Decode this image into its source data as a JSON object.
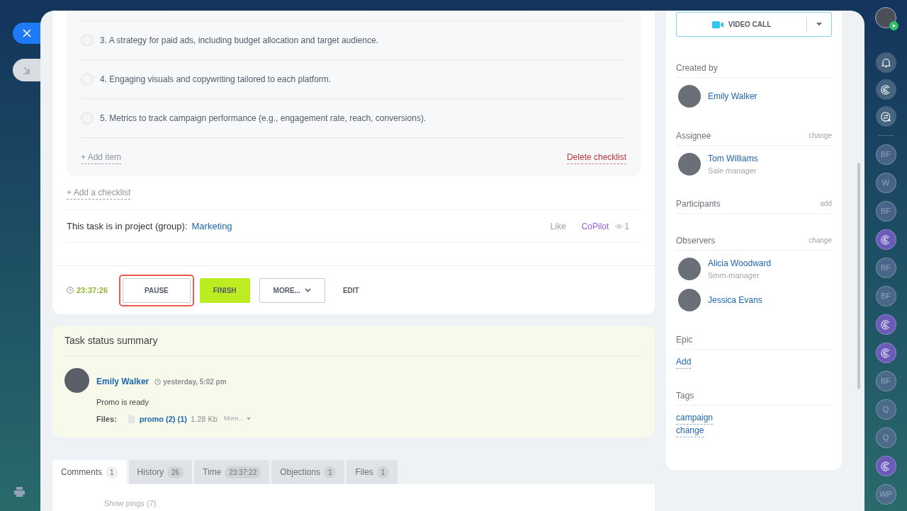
{
  "checklist": {
    "items": [
      {
        "text": "3. A strategy for paid ads, including budget allocation and target audience.",
        "checked": false
      },
      {
        "text": "4. Engaging visuals and copywriting tailored to each platform.",
        "checked": false
      },
      {
        "text": "5. Metrics to track campaign performance (e.g., engagement rate, reach, conversions).",
        "checked": false
      }
    ],
    "add_item": "+ Add item",
    "delete": "Delete checklist"
  },
  "add_checklist": "+ Add a checklist",
  "project": {
    "label": "This task is in project (group):",
    "link": "Marketing",
    "like": "Like",
    "copilot": "CoPilot",
    "views": "1"
  },
  "actions": {
    "timer": "23:37:26",
    "buttons": [
      {
        "label": "PAUSE",
        "kind": "outline",
        "highlighted": true
      },
      {
        "label": "FINISH",
        "kind": "primary",
        "highlighted": false
      },
      {
        "label": "MORE...",
        "kind": "dropdown",
        "highlighted": false
      },
      {
        "label": "EDIT",
        "kind": "link",
        "highlighted": false
      }
    ]
  },
  "summary": {
    "title": "Task status summary",
    "author": "Emily Walker",
    "time": "yesterday, 5:02 pm",
    "text": "Promo is ready",
    "files_label": "Files:",
    "file": "promo (2) (1)",
    "size": "1.28 Kb",
    "more": "More..."
  },
  "tabs": [
    {
      "label": "Comments",
      "count": "1",
      "selected": true
    },
    {
      "label": "History",
      "count": "26",
      "selected": false
    },
    {
      "label": "Time",
      "count": "23:37:22",
      "selected": false
    },
    {
      "label": "Objections",
      "count": "1",
      "selected": false
    },
    {
      "label": "Files",
      "count": "1",
      "selected": false
    }
  ],
  "show_pings": "Show pings (7)",
  "sidebar": {
    "video_call": "VIDEO CALL",
    "sections": [
      {
        "title": "Created by",
        "people": [
          {
            "name": "Emily Walker"
          }
        ]
      },
      {
        "title": "Assignee",
        "action": "change",
        "people": [
          {
            "name": "Tom Williams",
            "role": "Sale manager"
          }
        ]
      },
      {
        "title": "Participants",
        "action": "add"
      },
      {
        "title": "Observers",
        "action": "change",
        "people": [
          {
            "name": "Alicia Woodward",
            "role": "Smm-manager"
          },
          {
            "name": "Jessica Evans"
          }
        ]
      },
      {
        "title": "Epic",
        "links": [
          "Add"
        ]
      },
      {
        "title": "Tags",
        "links": [
          "campaign",
          "change"
        ]
      }
    ]
  },
  "right_bar": [
    {
      "kind": "initials",
      "text": "BF"
    },
    {
      "kind": "initials",
      "text": "W"
    },
    {
      "kind": "initials",
      "text": "BF"
    },
    {
      "kind": "copilot"
    },
    {
      "kind": "initials",
      "text": "BF"
    },
    {
      "kind": "initials",
      "text": "BF"
    },
    {
      "kind": "copilot"
    },
    {
      "kind": "copilot"
    },
    {
      "kind": "initials",
      "text": "BF"
    },
    {
      "kind": "initials",
      "text": "Q"
    },
    {
      "kind": "initials",
      "text": "Q"
    },
    {
      "kind": "copilot"
    },
    {
      "kind": "initials",
      "text": "WP"
    }
  ]
}
